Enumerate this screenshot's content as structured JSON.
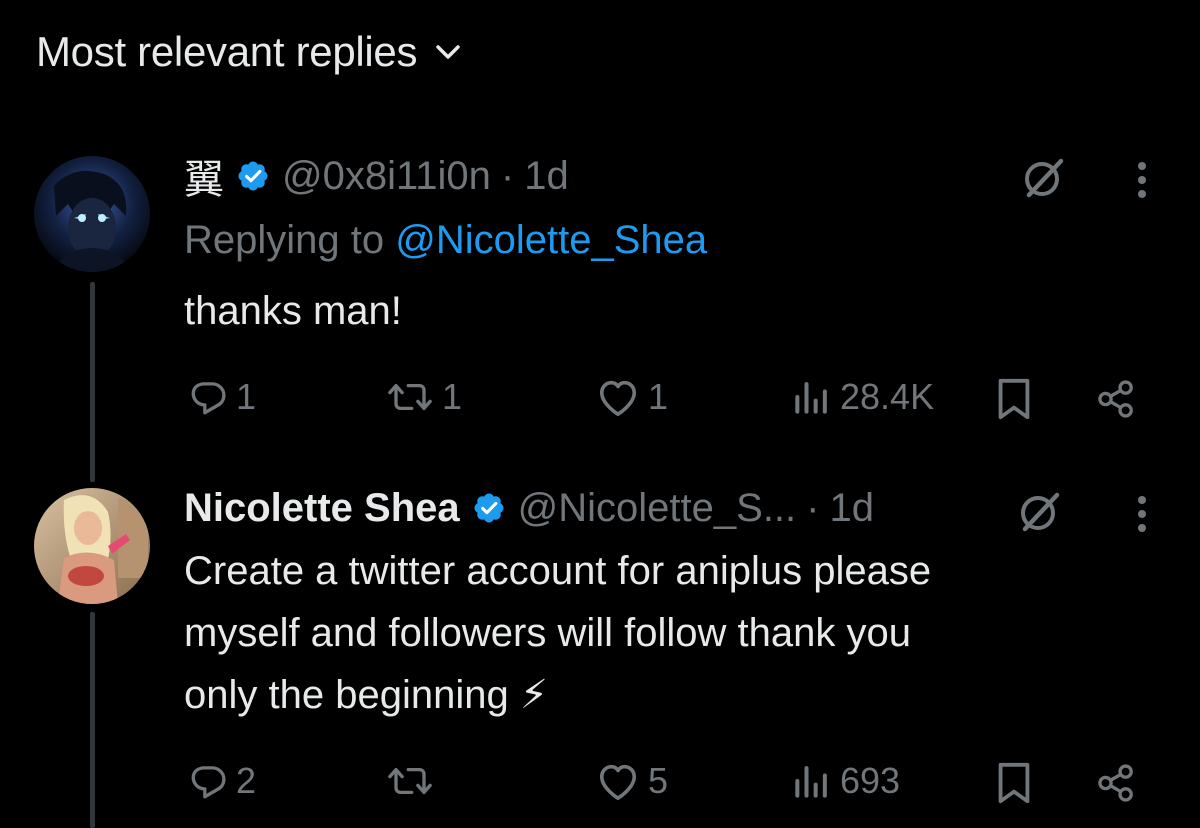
{
  "header": {
    "sort_label": "Most relevant replies"
  },
  "tweets": [
    {
      "display_name": "翼",
      "handle": "@0x8i11i0n",
      "separator": "·",
      "time": "1d",
      "replying_prefix": "Replying to ",
      "replying_to": "@Nicolette_Shea",
      "text": "thanks man!",
      "replies": "1",
      "reposts": "1",
      "likes": "1",
      "views": "28.4K"
    },
    {
      "display_name": "Nicolette Shea",
      "handle": "@Nicolette_S...",
      "separator": "·",
      "time": "1d",
      "text": "Create a twitter account for aniplus please\nmyself and followers will follow thank you\nonly the beginning ⚡",
      "replies": "2",
      "reposts": "",
      "likes": "5",
      "views": "693"
    }
  ],
  "colors": {
    "background": "#000000",
    "primary_text": "#e7e9ea",
    "secondary_text": "#71767b",
    "link": "#1d9bf0",
    "verified": "#1d9bf0",
    "thread_line": "#333639"
  },
  "icons": {
    "sort": "chevron-down-icon",
    "verified": "verified-badge-icon",
    "grok": "grok-icon",
    "more": "more-vertical-icon",
    "reply": "reply-icon",
    "repost": "repost-icon",
    "like": "heart-icon",
    "views": "views-icon",
    "bookmark": "bookmark-icon",
    "share": "share-icon"
  }
}
